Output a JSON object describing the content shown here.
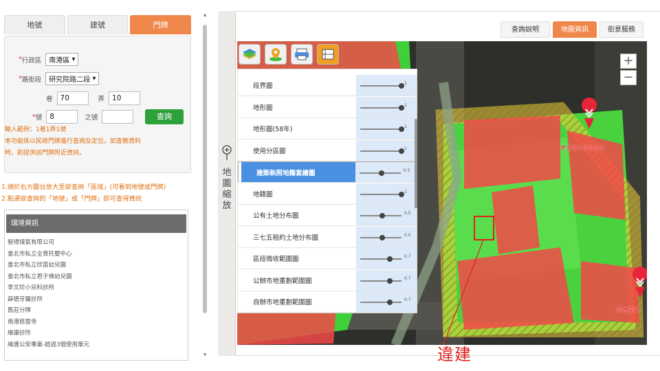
{
  "left": {
    "tabs": [
      {
        "label": "地號",
        "active": false
      },
      {
        "label": "建號",
        "active": false
      },
      {
        "label": "門牌",
        "active": true
      }
    ],
    "form": {
      "district_label": "行政區",
      "district_value": "南港區",
      "road_label": "路街段",
      "road_value": "研究院路二段",
      "lane_label": "巷",
      "lane_value": "70",
      "alley_label": "弄",
      "alley_value": "10",
      "number_label": "號",
      "number_value": "8",
      "sub_number_label": "之號",
      "sub_number_value": "",
      "query_button": "查詢",
      "example": "輸入範例：1巷1弄1號",
      "note_line1": "本功能係以民政門牌進行查詢及定位，如查無資料",
      "note_line2": "時，則提供該門牌附近資訊。"
    },
    "help_line1": "1.請於右方圖台放大至欲查詢「區域」(可看到地號或門牌)",
    "help_line2": "2.點選欲查詢的「地號」或「門牌」即可查得資訊",
    "env_title": "環境資訊",
    "env_items": [
      "智得煤氣有限公司",
      "臺北市私立全育托嬰中心",
      "臺北市私立欣苗幼兒園",
      "臺北市私立君子佛幼兒園",
      "李文珍小兒科診所",
      "薛德牙醫診所",
      "舊莊分隊",
      "南港慈雲寺",
      "維康診所",
      "維護公安專案-超過3個使用單元"
    ]
  },
  "right": {
    "tabs": [
      {
        "label": "查詢說明",
        "active": false
      },
      {
        "label": "地圖資訊",
        "active": true
      },
      {
        "label": "街景服務",
        "active": false
      }
    ],
    "zoom_label": "地圖縮放",
    "zoom_in": "+",
    "zoom_out": "−",
    "layers": [
      {
        "name": "段界圖",
        "value": "1",
        "level": 1,
        "selected": false
      },
      {
        "name": "地形圖",
        "value": "1",
        "level": 1,
        "selected": false
      },
      {
        "name": "地形圖(58年)",
        "value": "1",
        "level": 1,
        "selected": false
      },
      {
        "name": "使用分區圖",
        "value": "1",
        "level": 1,
        "selected": false
      },
      {
        "name": "建築執照地籍套繪圖",
        "value": "0.5",
        "level": 0.5,
        "selected": true
      },
      {
        "name": "地籍圖",
        "value": "1",
        "level": 1,
        "selected": false
      },
      {
        "name": "公有土地分布圖",
        "value": "0.5",
        "level": 0.5,
        "selected": false
      },
      {
        "name": "三七五租約土地分布圖",
        "value": "0.5",
        "level": 0.5,
        "selected": false
      },
      {
        "name": "區段徵收範圍圖",
        "value": "0.7",
        "level": 0.7,
        "selected": false
      },
      {
        "name": "公辦市地重劃範圍圖",
        "value": "0.7",
        "level": 0.7,
        "selected": false
      },
      {
        "name": "自辦市地重劃範圍圖",
        "value": "0.7",
        "level": 0.7,
        "selected": false
      }
    ],
    "map_labels": {
      "clinic1": "李文珍小兒科診所",
      "clinic2": "薛德牙醫"
    },
    "annotation": "違建"
  },
  "colors": {
    "accent": "#f0874a",
    "query_green": "#2ea03a",
    "note_orange": "#e07010",
    "selected_layer": "#4a90e2",
    "illegal_red": "#e02020"
  }
}
